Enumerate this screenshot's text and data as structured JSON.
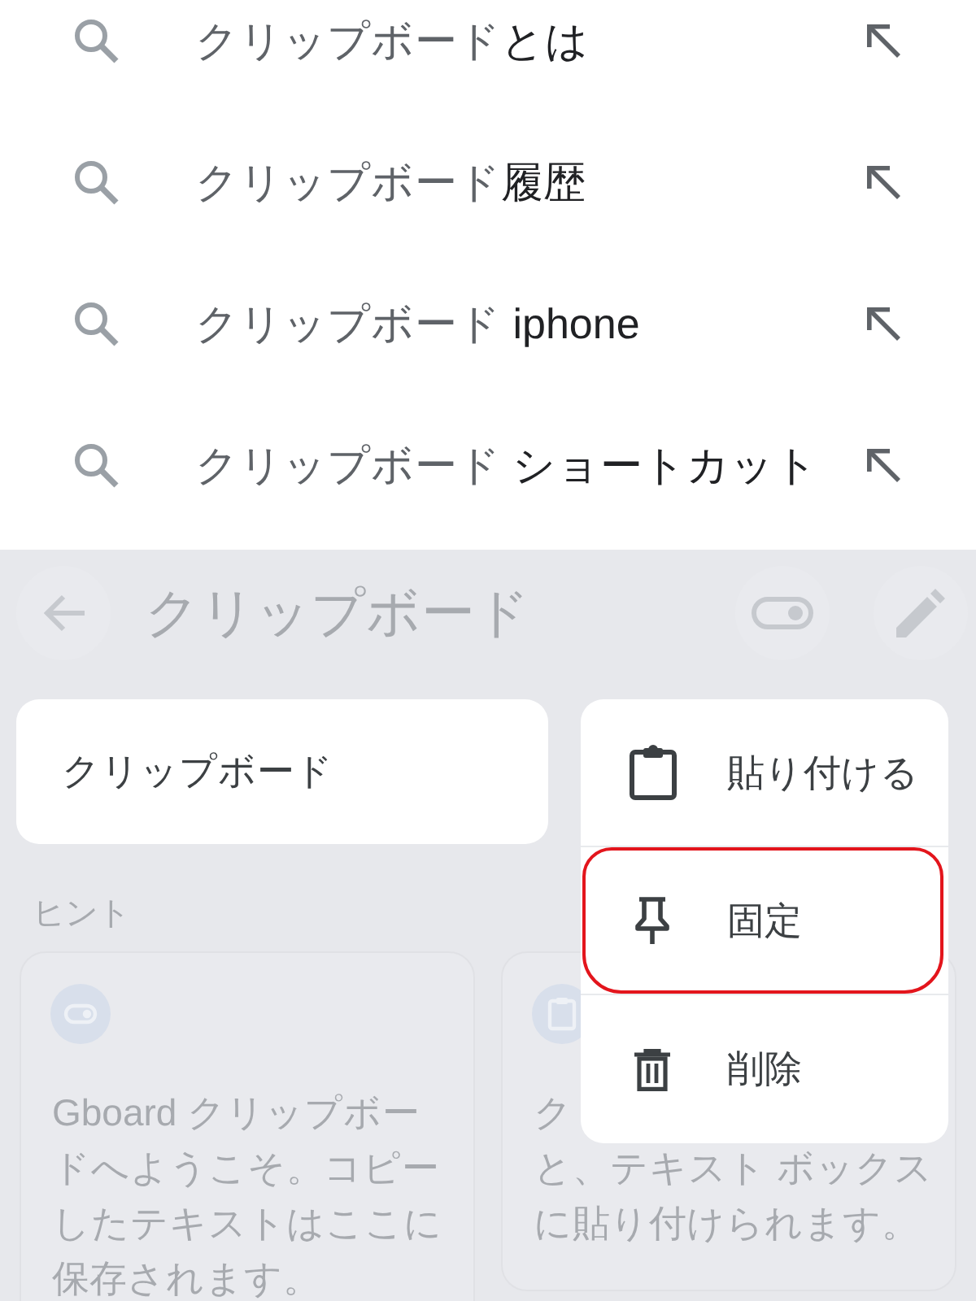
{
  "suggestions": [
    {
      "query": "クリップボード",
      "completion": "とは"
    },
    {
      "query": "クリップボード",
      "completion": "履歴"
    },
    {
      "query": "クリップボード",
      "completion": " iphone"
    },
    {
      "query": "クリップボード",
      "completion": " ショートカット"
    }
  ],
  "clipboard_screen": {
    "toolbar": {
      "title": "クリップボード"
    },
    "clip": {
      "text": "クリップボード"
    },
    "hints": {
      "heading": "ヒント",
      "cards": [
        {
          "kind": "toggle",
          "lines": [
            "Gboard クリップボー",
            "ドへようこそ。コピー",
            "したテキストはここに",
            "保存されます。"
          ]
        },
        {
          "kind": "clipboard",
          "lines": [
            "ク",
            "と、テキスト ボックス",
            "に貼り付けられます。"
          ]
        }
      ]
    }
  },
  "context_menu": {
    "items": [
      {
        "kind": "paste",
        "label": "貼り付ける",
        "highlighted": false
      },
      {
        "kind": "pin",
        "label": "固定",
        "highlighted": true
      },
      {
        "kind": "delete",
        "label": "削除",
        "highlighted": false
      }
    ]
  }
}
